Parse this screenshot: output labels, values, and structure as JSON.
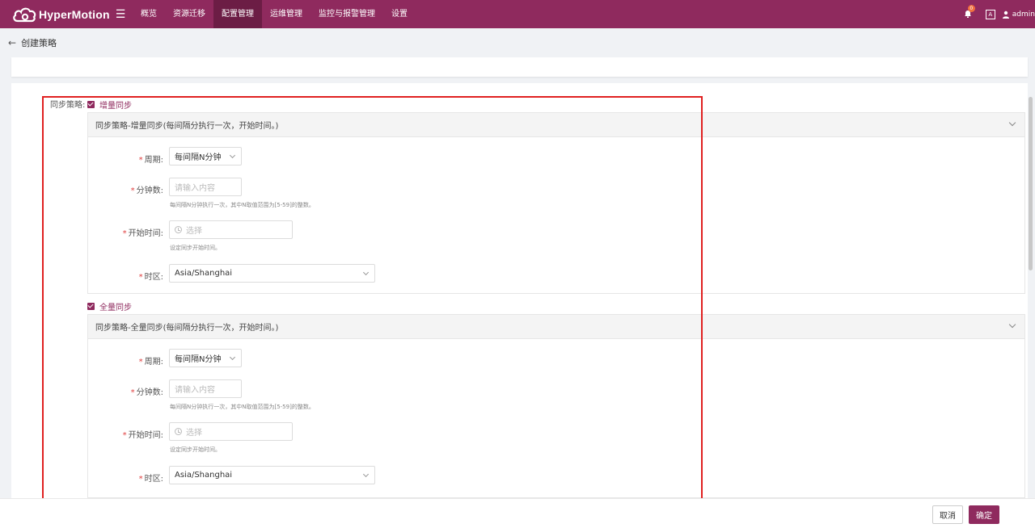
{
  "app": {
    "name": "HyperMotion"
  },
  "nav": {
    "items": [
      {
        "label": "概览"
      },
      {
        "label": "资源迁移"
      },
      {
        "label": "配置管理"
      },
      {
        "label": "运维管理"
      },
      {
        "label": "监控与报警管理"
      },
      {
        "label": "设置"
      }
    ],
    "active_index": 2
  },
  "topbar": {
    "notification_count": "0",
    "lang_label": "A",
    "user": "admin"
  },
  "page": {
    "title": "创建策略"
  },
  "form": {
    "policy_label": "同步策略:",
    "incremental": {
      "check_label": "增量同步",
      "panel_title": "同步策略-增量同步(每间隔分执行一次，开始时间。)",
      "period_label": "周期:",
      "period_value": "每间隔N分钟",
      "minutes_label": "分钟数:",
      "minutes_placeholder": "请输入内容",
      "minutes_hint": "每间隔N分钟执行一次，其中N取值范围为[5-59]的整数。",
      "start_label": "开始时间:",
      "start_placeholder": "选择",
      "start_hint": "设定同步开始时间。",
      "tz_label": "时区:",
      "tz_value": "Asia/Shanghai"
    },
    "full": {
      "check_label": "全量同步",
      "panel_title": "同步策略-全量同步(每间隔分执行一次，开始时间。)",
      "period_label": "周期:",
      "period_value": "每间隔N分钟",
      "minutes_label": "分钟数:",
      "minutes_placeholder": "请输入内容",
      "minutes_hint": "每间隔N分钟执行一次，其中N取值范围为[5-59]的整数。",
      "start_label": "开始时间:",
      "start_placeholder": "选择",
      "start_hint": "设定同步开始时间。",
      "tz_label": "时区:",
      "tz_value": "Asia/Shanghai"
    }
  },
  "footer": {
    "cancel_label": "取消",
    "ok_label": "确定"
  },
  "colors": {
    "brand": "#8f2a5e",
    "highlight": "#e02020"
  }
}
